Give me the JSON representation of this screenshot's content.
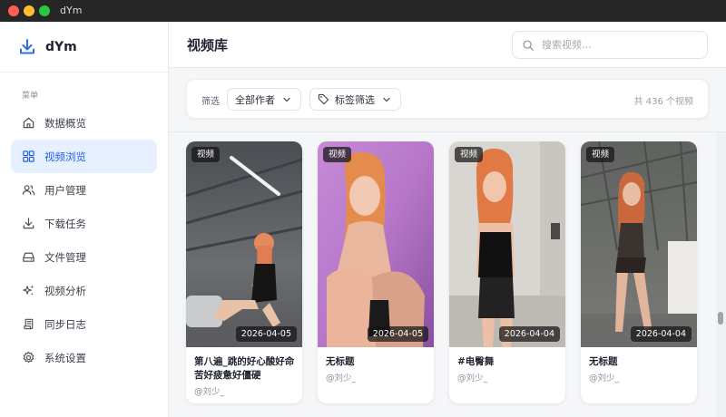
{
  "window": {
    "title": "dYm"
  },
  "brand": {
    "name": "dYm"
  },
  "sidebar": {
    "section_title": "菜单",
    "items": [
      {
        "label": "数据概览",
        "icon": "home-icon"
      },
      {
        "label": "视频浏览",
        "icon": "grid-icon",
        "active": true
      },
      {
        "label": "用户管理",
        "icon": "users-icon"
      },
      {
        "label": "下载任务",
        "icon": "download-icon"
      },
      {
        "label": "文件管理",
        "icon": "drive-icon"
      },
      {
        "label": "视频分析",
        "icon": "sparkles-icon"
      },
      {
        "label": "同步日志",
        "icon": "scroll-icon"
      },
      {
        "label": "系统设置",
        "icon": "gear-icon"
      }
    ]
  },
  "header": {
    "title": "视频库",
    "search_placeholder": "搜索视频..."
  },
  "filters": {
    "label": "筛选",
    "author_value": "全部作者",
    "tag_value": "标签筛选",
    "count_text": "共 436 个视频"
  },
  "videos": [
    {
      "badge": "视频",
      "date": "2026-04-05",
      "title": "第八遍_跳的好心酸好命苦好疲惫好僵硬",
      "author": "@刘少_"
    },
    {
      "badge": "视频",
      "date": "2026-04-05",
      "title": "无标题",
      "author": "@刘少_"
    },
    {
      "badge": "视频",
      "date": "2026-04-04",
      "title": "#电臀舞",
      "author": "@刘少_"
    },
    {
      "badge": "视频",
      "date": "2026-04-04",
      "title": "无标题",
      "author": "@刘少_"
    }
  ],
  "colors": {
    "accent": "#1f63e0",
    "active_bg": "#e7f0ff",
    "download_icon": "#2f6fe4"
  }
}
